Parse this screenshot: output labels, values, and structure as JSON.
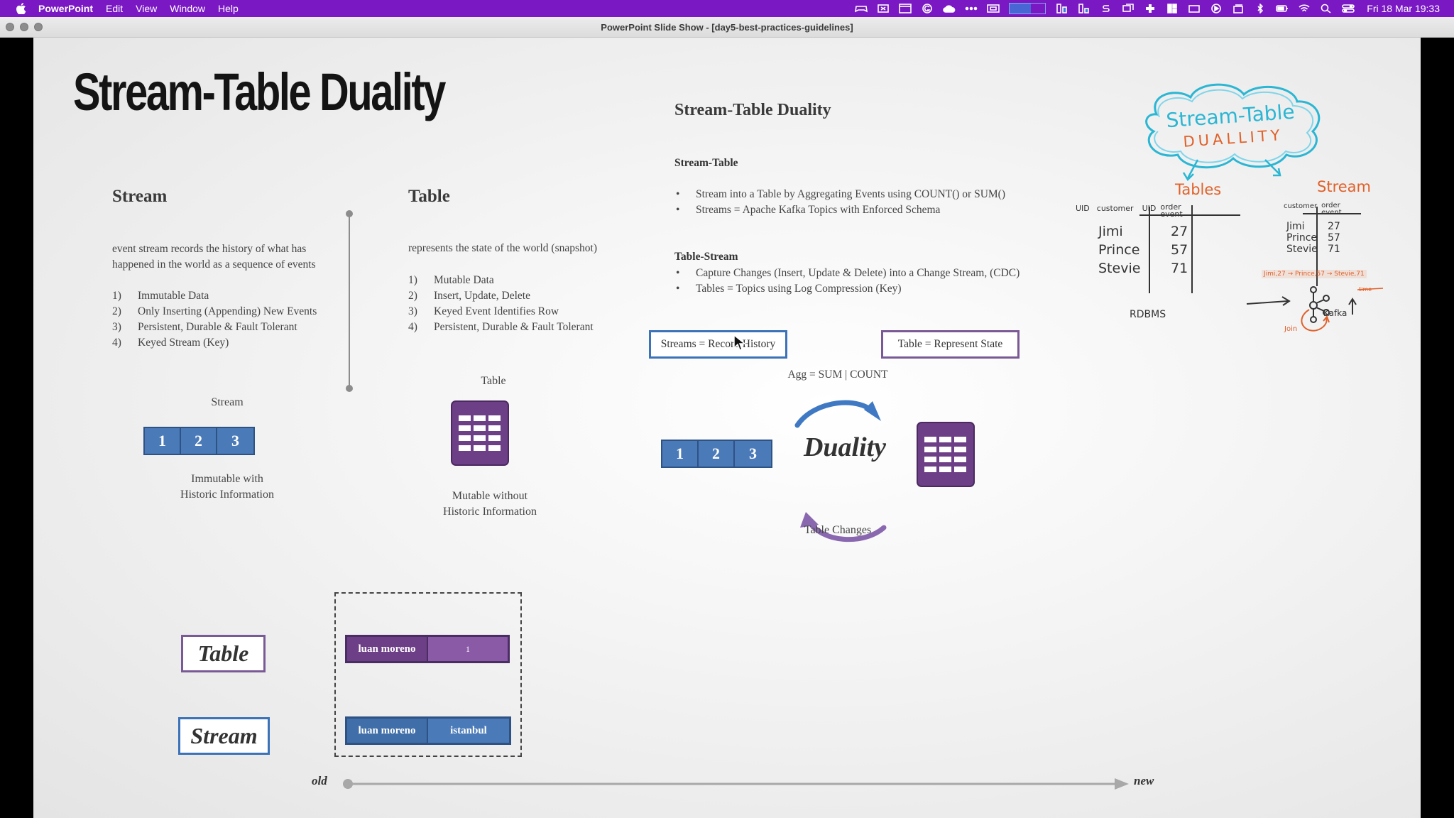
{
  "menubar": {
    "app_name": "PowerPoint",
    "menus": [
      "Edit",
      "View",
      "Window",
      "Help"
    ],
    "clock": "Fri 18 Mar  19:33"
  },
  "window": {
    "title": "PowerPoint Slide Show - [day5-best-practices-guidelines]"
  },
  "slide": {
    "title": "Stream-Table Duality",
    "stream": {
      "heading": "Stream",
      "description_line1": "event stream records the history of what has",
      "description_line2": "happened in the world as a sequence of events",
      "items": [
        {
          "n": "1)",
          "text": "Immutable Data"
        },
        {
          "n": "2)",
          "text": "Only Inserting (Appending) New Events"
        },
        {
          "n": "3)",
          "text": "Persistent, Durable & Fault Tolerant"
        },
        {
          "n": "4)",
          "text": "Keyed Stream (Key)"
        }
      ],
      "diagram_label": "Stream",
      "cells": [
        "1",
        "2",
        "3"
      ],
      "caption_line1": "Immutable with",
      "caption_line2": "Historic Information"
    },
    "table": {
      "heading": "Table",
      "description": "represents the state of the world (snapshot)",
      "items": [
        {
          "n": "1)",
          "text": "Mutable Data"
        },
        {
          "n": "2)",
          "text": "Insert, Update, Delete"
        },
        {
          "n": "3)",
          "text": "Keyed Event Identifies Row"
        },
        {
          "n": "4)",
          "text": "Persistent, Durable & Fault Tolerant"
        }
      ],
      "diagram_label": "Table",
      "caption_line1": "Mutable without",
      "caption_line2": "Historic Information"
    },
    "duality": {
      "heading": "Stream-Table Duality",
      "stream_table_heading": "Stream-Table",
      "stream_table_bullets": [
        "Stream into a Table by Aggregating Events using COUNT() or SUM()",
        "Streams = Apache Kafka Topics with Enforced Schema"
      ],
      "table_stream_heading": "Table-Stream",
      "table_stream_bullets": [
        "Capture Changes (Insert, Update & Delete) into a Change Stream, (CDC)",
        "Tables = Topics using Log Compression (Key)"
      ],
      "box_left": "Streams = Record History",
      "box_right": "Table = Represent State",
      "agg_label": "Agg = SUM | COUNT",
      "center_word": "Duality",
      "changes_label": "Table Changes",
      "cells": [
        "1",
        "2",
        "3"
      ]
    },
    "sketch": {
      "cloud_line1": "Stream-Table",
      "cloud_line2": "DUALLITY",
      "tables_title": "Tables",
      "stream_title": "Stream",
      "table_headers": [
        "UID",
        "customer",
        "UID",
        "order event"
      ],
      "table_rows": [
        {
          "name": "Jimi",
          "value": "27"
        },
        {
          "name": "Prince",
          "value": "57"
        },
        {
          "name": "Stevie",
          "value": "71"
        }
      ],
      "stream_headers": [
        "customer",
        "order event"
      ],
      "stream_rows": [
        {
          "name": "Jimi",
          "value": "27"
        },
        {
          "name": "Prince",
          "value": "57"
        },
        {
          "name": "Stevie",
          "value": "71"
        }
      ],
      "rdbms_label": "RDBMS",
      "event_line": "Jimi,27 → Prince,57 → Stevie,71",
      "time_label": "time",
      "kafka_label": "Kafka",
      "join_label": "Join"
    },
    "bottom": {
      "table_tag": "Table",
      "stream_tag": "Stream",
      "table_record": [
        "luan moreno",
        "1"
      ],
      "stream_record": [
        "luan moreno",
        "istanbul"
      ],
      "old_label": "old",
      "new_label": "new"
    }
  },
  "colors": {
    "menubar": "#7a18c4",
    "stream_blue": "#3f6ea8",
    "table_purple": "#6d3f86",
    "sketch_orange": "#e0612a",
    "sketch_cyan": "#2bb6d3"
  }
}
